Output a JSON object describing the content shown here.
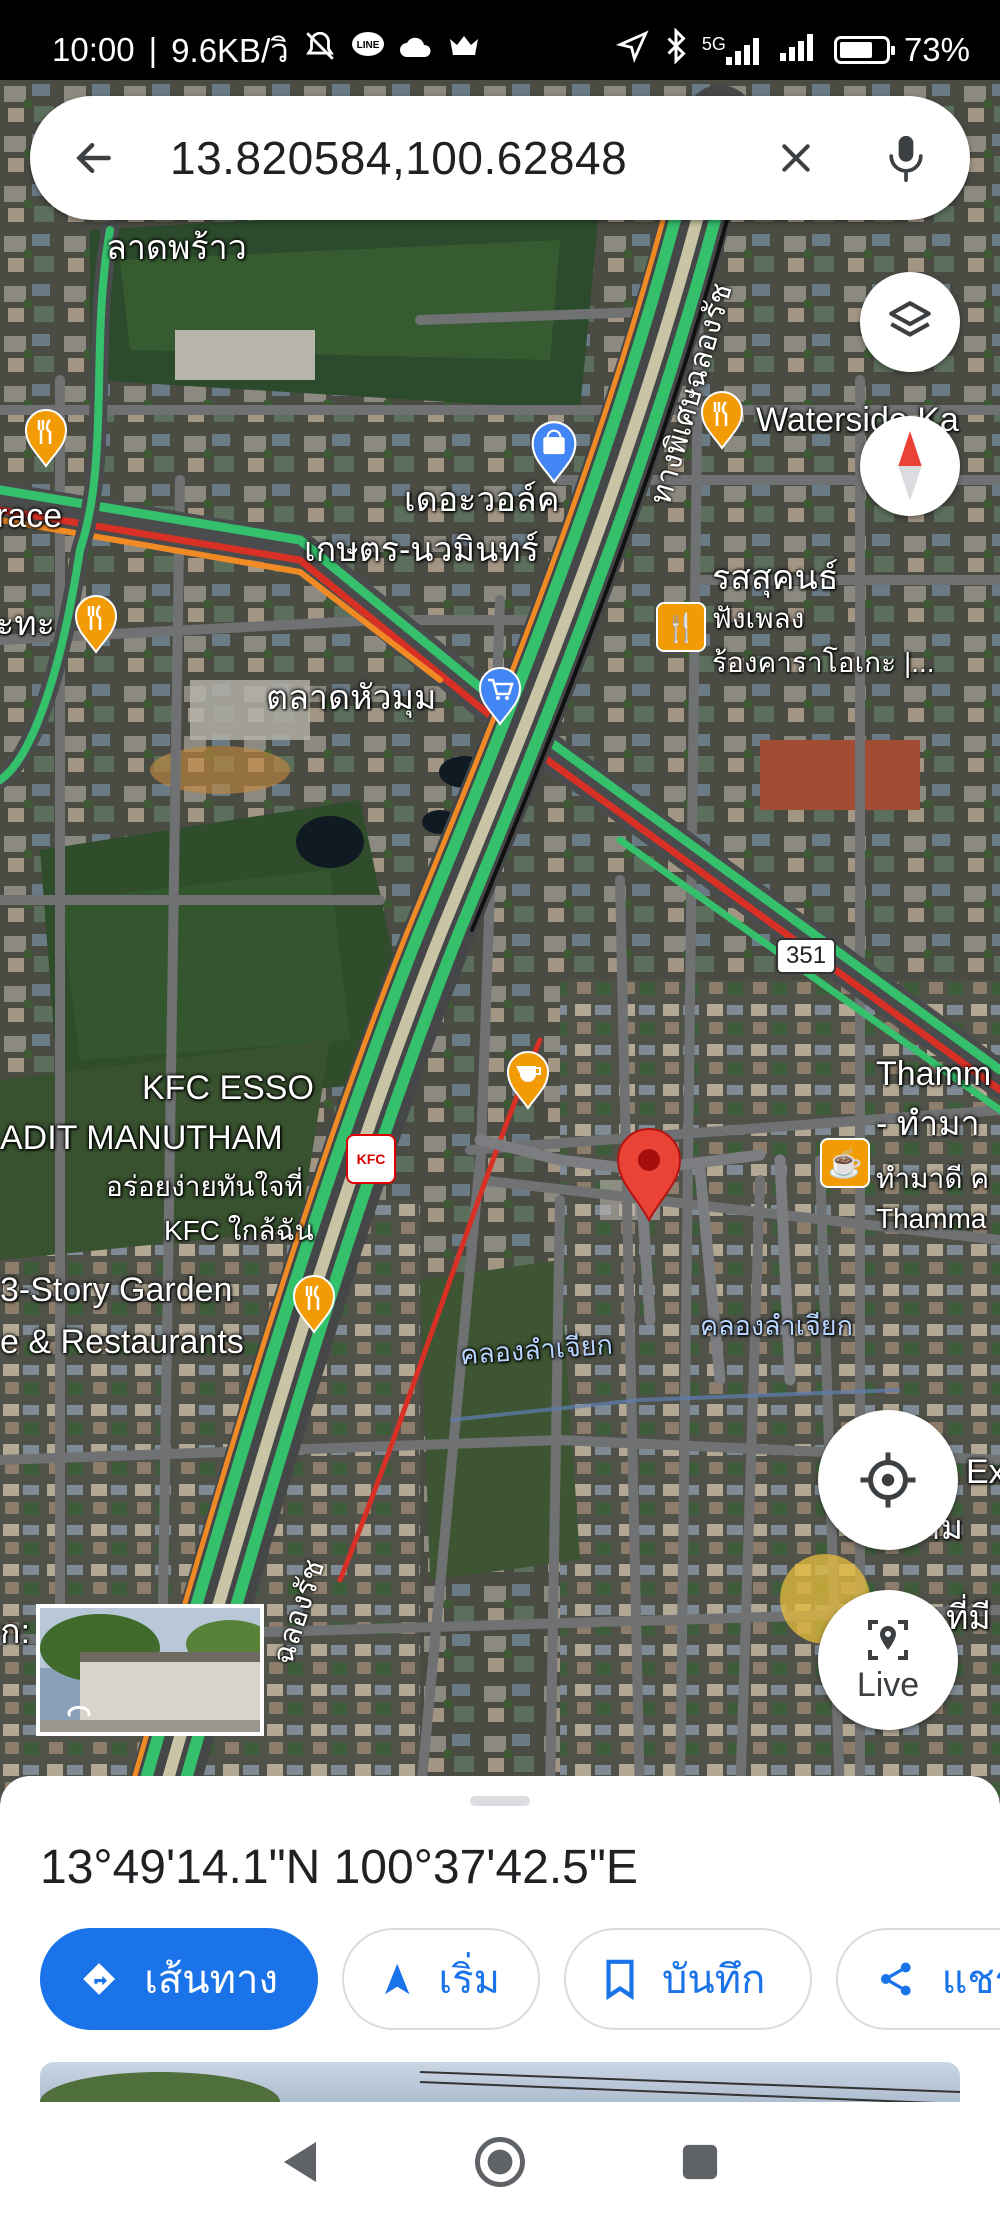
{
  "status_bar": {
    "time": "10:00",
    "speed": "9.6KB/วิ",
    "network": "5G",
    "battery": "73%",
    "battery_level": 0.73
  },
  "search": {
    "query": "13.820584,100.62848"
  },
  "map": {
    "labels": {
      "lat_phrao": "ลาดพร้าว",
      "terrace": "race",
      "te_ha": "ะทะ",
      "the_walk": "เดอะวอล์ค",
      "kaset_nawamin": "เกษตร-นวมินทร์",
      "talat_huamum": "ตลาดหัวมุม",
      "waterside": "Waterside Ka",
      "rossukhon_1": "รสสุคนธ์",
      "rossukhon_2": "ฟังเพลง",
      "rossukhon_3": "ร้องคาราโอเกะ |...",
      "kfc_1": "KFC ESSO",
      "kfc_2": "ADIT MANUTHAM",
      "kfc_3": "อร่อยง่ายทันใจที่",
      "kfc_4": "KFC ใกล้ฉัน",
      "garden_1": "3-Story Garden",
      "garden_2": "e & Restaurants",
      "thamma_1": "Thamm",
      "thamma_2": "- ทำมา",
      "thamma_3": "ทำมาดี ค",
      "thamma_4": "Thamma",
      "khlong_lamchiak_1": "คลองลำเจียก",
      "khlong_lamchiak_2": "คลองลำเจียก",
      "right_ex": "Ex",
      "right_ram": "นราม",
      "right_thimi": "ที่มี",
      "left_ka": "ก:",
      "highway_top": "ทางพิเศษฉลองรัช",
      "highway_bottom": "ฉลองรัช",
      "route_351": "351"
    }
  },
  "controls": {
    "live_label": "Live"
  },
  "place": {
    "coordinates": "13°49'14.1\"N 100°37'42.5\"E",
    "actions": {
      "directions": "เส้นทาง",
      "start": "เริ่ม",
      "save": "บันทึก",
      "share": "แชร์"
    }
  },
  "colors": {
    "accent": "#1a73e8",
    "pin": "#ea4335",
    "poi_orange": "#f29b05",
    "traffic_green": "#35c06c",
    "traffic_orange": "#f08a24",
    "traffic_red": "#d93025"
  }
}
